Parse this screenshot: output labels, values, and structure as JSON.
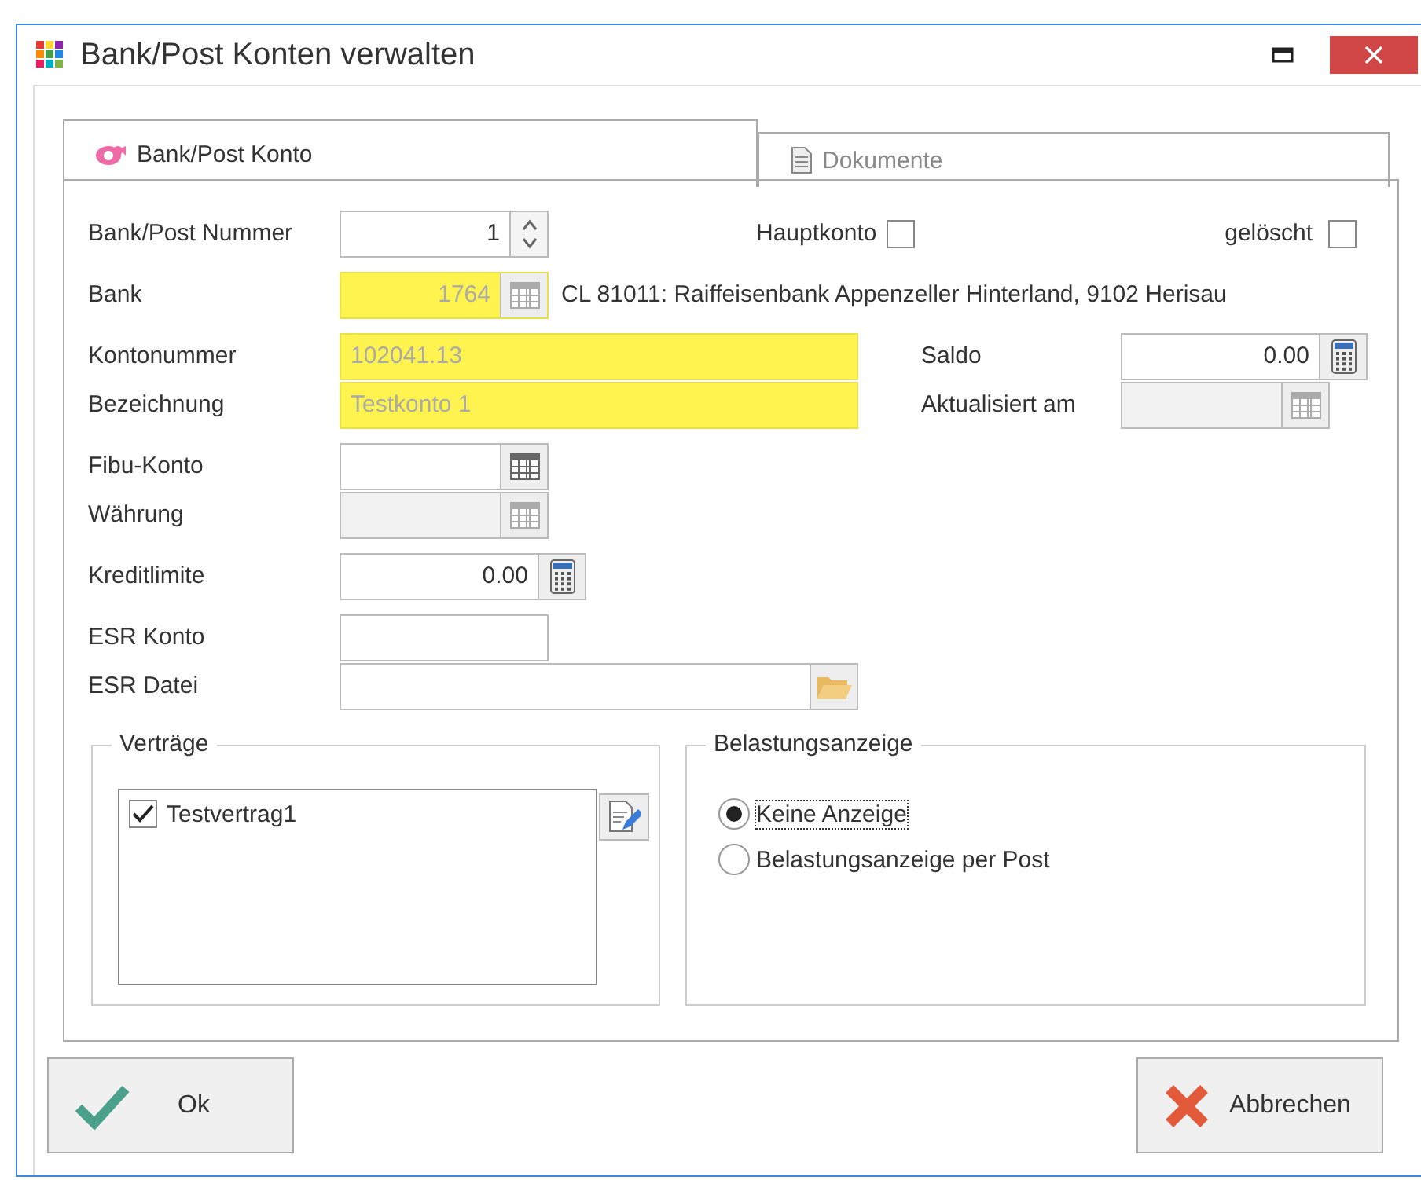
{
  "window": {
    "title": "Bank/Post Konten verwalten"
  },
  "tabs": [
    {
      "label": "Bank/Post Konto",
      "selected": true
    },
    {
      "label": "Dokumente",
      "selected": false
    }
  ],
  "bank_post_nummer": {
    "label": "Bank/Post Nummer",
    "value": "1"
  },
  "hauptkonto": {
    "label": "Hauptkonto",
    "checked": false
  },
  "geloescht": {
    "label": "gelöscht",
    "checked": false
  },
  "bank": {
    "label": "Bank",
    "value": "1764",
    "disabled": true,
    "highlighted": true,
    "description": "CL 81011: Raiffeisenbank Appenzeller Hinterland, 9102 Herisau"
  },
  "kontonummer": {
    "label": "Kontonummer",
    "value": "102041.13",
    "disabled": true,
    "highlighted": true
  },
  "bezeichnung": {
    "label": "Bezeichnung",
    "value": "Testkonto 1",
    "disabled": true,
    "highlighted": true
  },
  "saldo": {
    "label": "Saldo",
    "value": "0.00"
  },
  "aktualisiert_am": {
    "label": "Aktualisiert am",
    "disabled": true
  },
  "fibu_konto": {
    "label": "Fibu-Konto",
    "disabled": false
  },
  "waehrung": {
    "label": "Währung",
    "disabled": true
  },
  "kreditlimite": {
    "label": "Kreditlimite",
    "value": "0.00"
  },
  "esr_konto": {
    "label": "ESR Konto"
  },
  "esr_datei": {
    "label": "ESR Datei"
  },
  "vertraege": {
    "title": "Verträge",
    "items": [
      {
        "label": "Testvertrag1",
        "checked": true
      }
    ]
  },
  "belastungsanzeige": {
    "title": "Belastungsanzeige",
    "options": [
      {
        "label": "Keine Anzeige",
        "selected": true
      },
      {
        "label": "Belastungsanzeige per Post",
        "selected": false
      }
    ]
  },
  "buttons": [
    {
      "label": "Ok",
      "kind": "ok"
    },
    {
      "label": "Abbrechen",
      "kind": "cancel"
    }
  ]
}
